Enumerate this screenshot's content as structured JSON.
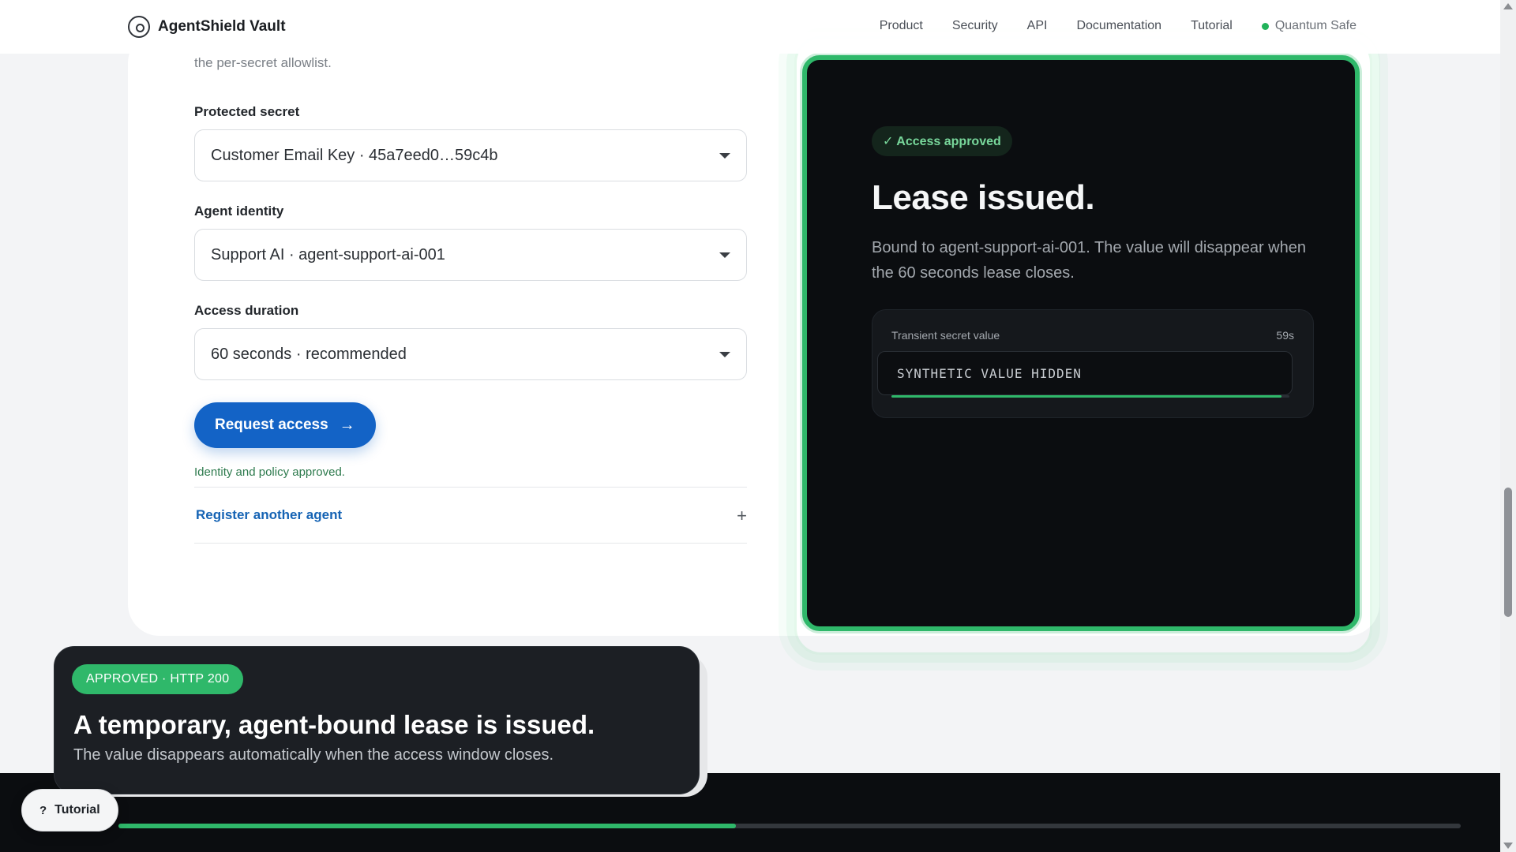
{
  "nav": {
    "brand": "AgentShield Vault",
    "links": [
      "Product",
      "Security",
      "API",
      "Documentation",
      "Tutorial"
    ],
    "status": "Quantum Safe"
  },
  "form": {
    "intro": "the per-secret allowlist.",
    "secret_label": "Protected secret",
    "secret_value": "Customer Email Key · 45a7eed0…59c4b",
    "agent_label": "Agent identity",
    "agent_value": "Support AI · agent-support-ai-001",
    "duration_label": "Access duration",
    "duration_value": "60 seconds · recommended",
    "request_button": "Request access",
    "request_arrow": "→",
    "approved_note": "Identity and policy approved.",
    "register_link": "Register another agent",
    "register_plus": "+"
  },
  "lease": {
    "chip": "✓ Access approved",
    "title": "Lease issued.",
    "description": "Bound to agent-support-ai-001. The value will disappear when the 60 seconds lease closes.",
    "secret_label": "Transient secret value",
    "timer": "59s",
    "secret_value": "SYNTHETIC VALUE HIDDEN",
    "remaining_fraction": 0.98
  },
  "tutorial": {
    "badge": "APPROVED · HTTP 200",
    "title": "A temporary, agent-bound lease is issued.",
    "description": "The value disappears automatically when the access window closes.",
    "pill_icon": "?",
    "pill_label": "Tutorial",
    "progress_fraction": 0.46
  },
  "colors": {
    "accent_green": "#2fb86a",
    "primary_blue": "#1363c6"
  }
}
